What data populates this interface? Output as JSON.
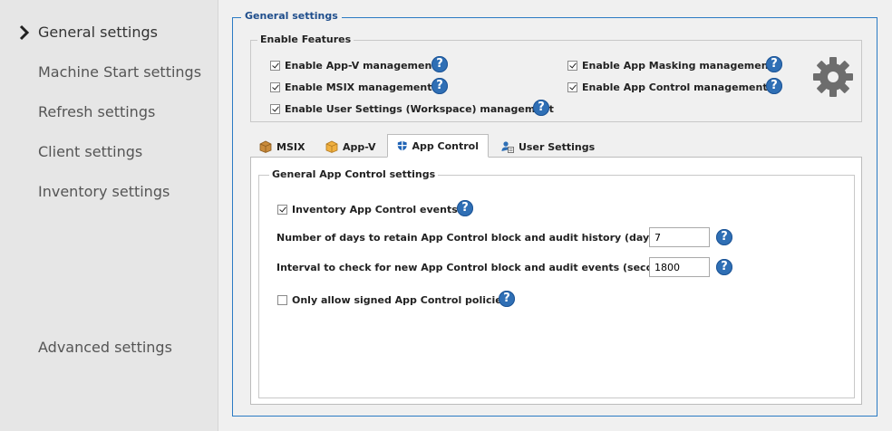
{
  "sidebar": {
    "items": [
      {
        "label": "General settings"
      },
      {
        "label": "Machine Start settings"
      },
      {
        "label": "Refresh settings"
      },
      {
        "label": "Client settings"
      },
      {
        "label": "Inventory settings"
      },
      {
        "label": "Advanced settings"
      }
    ],
    "active_icon": "chevron-right-icon"
  },
  "general": {
    "title": "General settings",
    "enable_features": {
      "title": "Enable Features",
      "options": [
        {
          "label": "Enable App-V management",
          "checked": true
        },
        {
          "label": "Enable MSIX management",
          "checked": true
        },
        {
          "label": "Enable User Settings (Workspace) management",
          "checked": true
        },
        {
          "label": "Enable App Masking management",
          "checked": true
        },
        {
          "label": "Enable App Control management",
          "checked": true
        }
      ],
      "settings_icon": "gear-icon"
    }
  },
  "tabs": [
    {
      "label": "MSIX",
      "icon": "package-icon",
      "active": false
    },
    {
      "label": "App-V",
      "icon": "box-icon",
      "active": false
    },
    {
      "label": "App Control",
      "icon": "shield-icon",
      "active": true
    },
    {
      "label": "User Settings",
      "icon": "user-settings-icon",
      "active": false
    }
  ],
  "app_control": {
    "group_title": "General App Control settings",
    "inventory_events": {
      "label": "Inventory App Control events",
      "checked": true
    },
    "retain_days": {
      "label": "Number of days to retain App Control block and audit history (days):",
      "value": "7"
    },
    "check_interval": {
      "label": "Interval to check for new App Control block and audit events (seconds):",
      "value": "1800"
    },
    "signed_policies": {
      "label": "Only allow signed App Control policies",
      "checked": false
    }
  },
  "help_symbol": "?",
  "colors": {
    "accent": "#2b7bc4",
    "help_icon": "#2f6fb5",
    "sidebar_bg": "#e6e6e6",
    "window_bg": "#f0f0f0"
  }
}
